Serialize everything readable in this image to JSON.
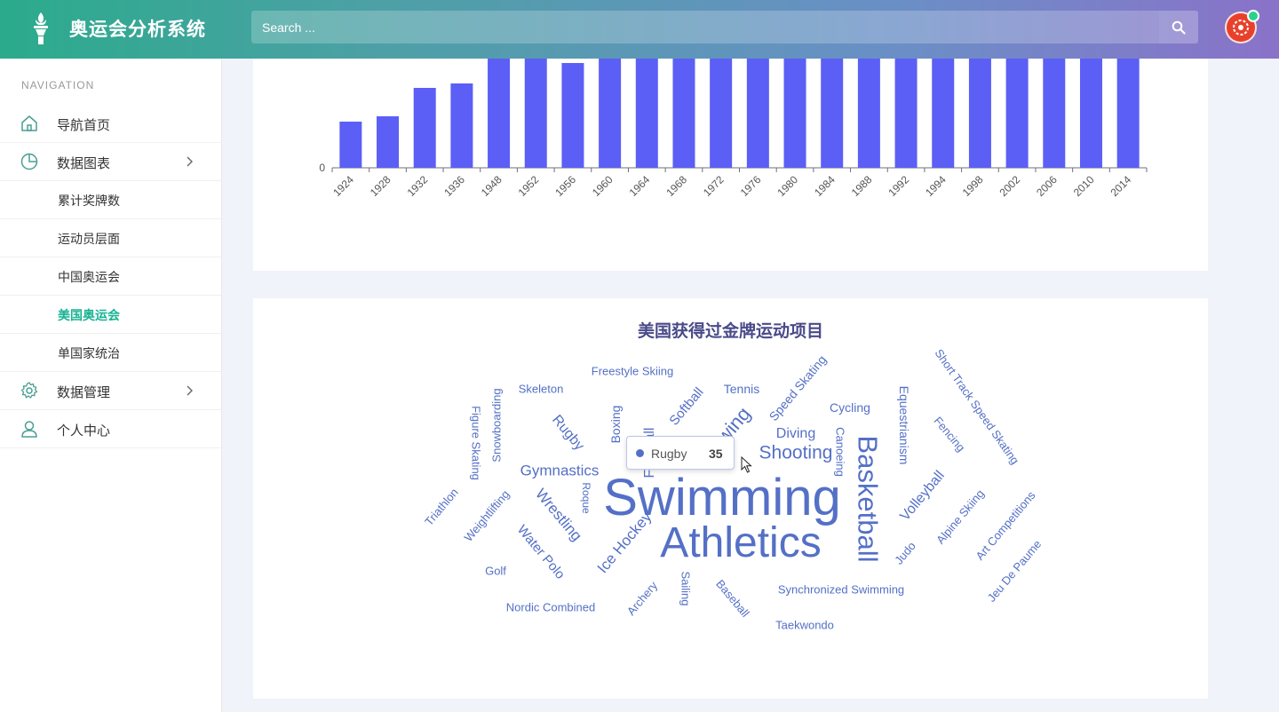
{
  "app": {
    "title": "奥运会分析系统"
  },
  "search": {
    "placeholder": "Search ..."
  },
  "sidebar": {
    "caption": "NAVIGATION",
    "items": [
      {
        "label": "导航首页",
        "icon": "home-icon"
      },
      {
        "label": "数据图表",
        "icon": "pie-chart-icon",
        "expanded": true,
        "children": [
          {
            "label": "累计奖牌数"
          },
          {
            "label": "运动员层面"
          },
          {
            "label": "中国奥运会"
          },
          {
            "label": "美国奥运会",
            "active": true
          },
          {
            "label": "单国家统治"
          }
        ]
      },
      {
        "label": "数据管理",
        "icon": "gear-icon"
      },
      {
        "label": "个人中心",
        "icon": "user-icon"
      }
    ]
  },
  "colors": {
    "accent": "#1ab394",
    "bar": "#5b5ff5",
    "word": "#5470c6"
  },
  "chart_data": [
    {
      "type": "bar",
      "categories": [
        "1924",
        "1928",
        "1932",
        "1936",
        "1948",
        "1952",
        "1956",
        "1960",
        "1964",
        "1968",
        "1972",
        "1976",
        "1980",
        "1984",
        "1988",
        "1992",
        "1994",
        "1998",
        "2002",
        "2006",
        "2010",
        "2014"
      ],
      "visible_ytick": "0"
    },
    {
      "type": "wordcloud",
      "title": "美国获得过金牌运动项目",
      "words": [
        "Swimming",
        "Athletics",
        "Basketball",
        "Shooting",
        "Gymnastics",
        "Diving",
        "Rugby",
        "Wrestling",
        "Ice Hockey",
        "Water Polo",
        "Volleyball",
        "Speed Skating",
        "Short Track Speed Skating",
        "Freestyle Skiing",
        "Skeleton",
        "Tennis",
        "Softball",
        "Boxing",
        "Cycling",
        "Canoeing",
        "Equestrianism",
        "Fencing",
        "Snowboarding",
        "Figure Skating",
        "Roque",
        "Triathlon",
        "Weightlifting",
        "Golf",
        "Nordic Combined",
        "Archery",
        "Sailing",
        "Baseball",
        "Synchronized Swimming",
        "Taekwondo",
        "Judo",
        "Alpine Skiing",
        "Art Competitions",
        "Jeu De Paume",
        "Football",
        "Rowing"
      ],
      "tooltip": {
        "name": "Rugby",
        "value": "35"
      }
    }
  ]
}
